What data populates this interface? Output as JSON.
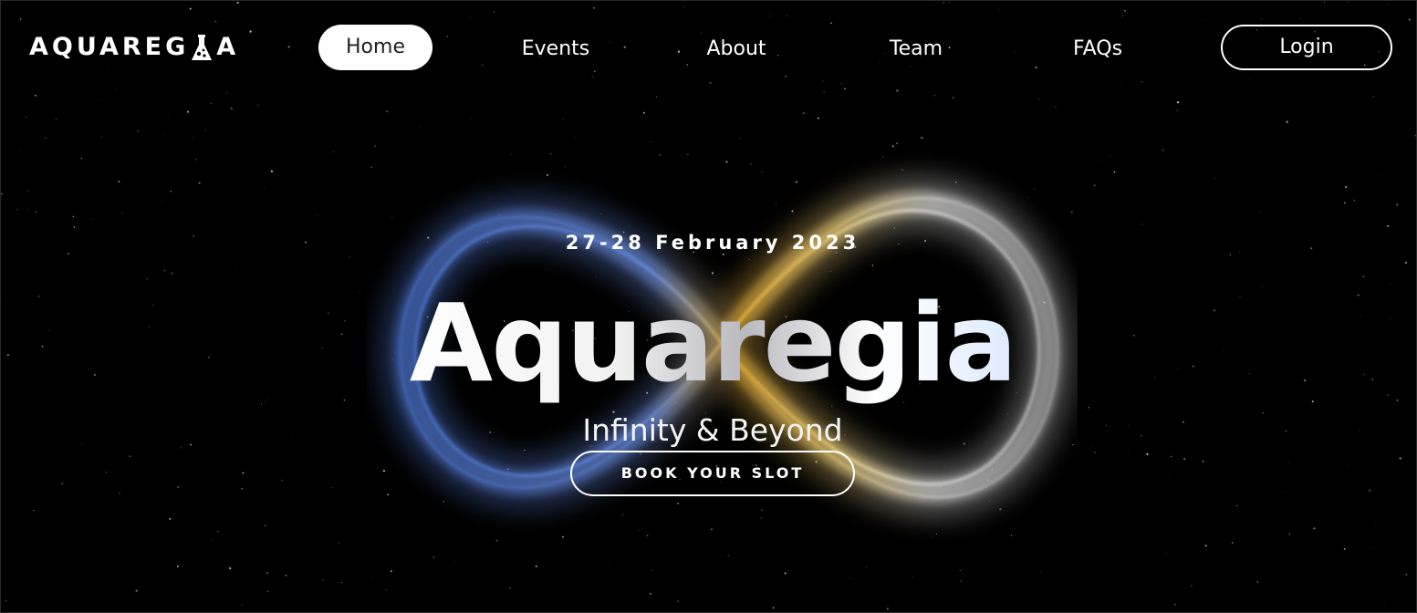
{
  "brand": {
    "logo_part1": "AQUAREG",
    "logo_part2": "A",
    "logo_icon": "flask-icon"
  },
  "nav": {
    "items": [
      {
        "label": "Home",
        "active": true
      },
      {
        "label": "Events",
        "active": false
      },
      {
        "label": "About",
        "active": false
      },
      {
        "label": "Team",
        "active": false
      },
      {
        "label": "FAQs",
        "active": false
      }
    ],
    "login_label": "Login"
  },
  "hero": {
    "date": "27-28 February 2023",
    "title": "Aquaregia",
    "subtitle": "Infinity & Beyond",
    "cta_label": "BOOK YOUR SLOT",
    "background": "starfield with glowing infinity symbol (blue left loop, gold/white right loop)"
  },
  "colors": {
    "background": "#000000",
    "text": "#ffffff",
    "active_nav_bg": "#ffffff",
    "active_nav_text": "#222222",
    "infinity_blue": "#5b86e0",
    "infinity_gold": "#e8b23c",
    "infinity_white": "#e9e9e9"
  }
}
